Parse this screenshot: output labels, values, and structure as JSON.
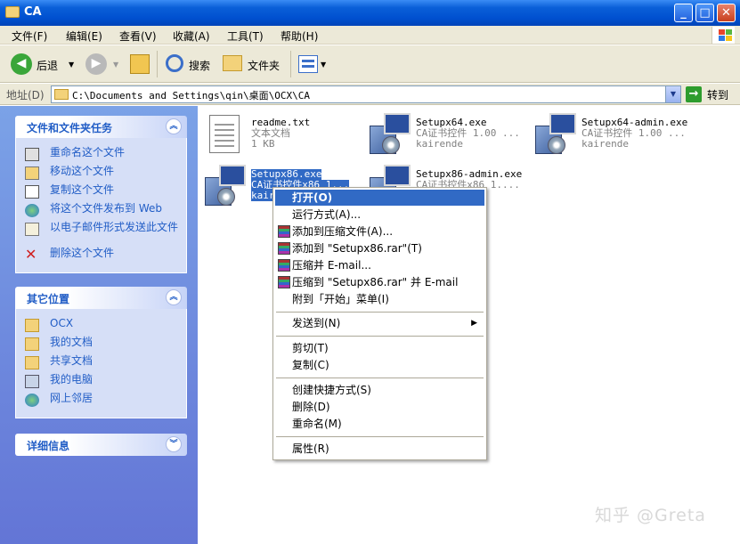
{
  "window": {
    "title": "CA"
  },
  "menubar": [
    "文件(F)",
    "编辑(E)",
    "查看(V)",
    "收藏(A)",
    "工具(T)",
    "帮助(H)"
  ],
  "toolbar": {
    "back": "后退",
    "search": "搜索",
    "folders": "文件夹"
  },
  "address": {
    "label": "地址(D)",
    "path": "C:\\Documents and Settings\\qin\\桌面\\OCX\\CA",
    "go": "转到"
  },
  "tasks_panel": {
    "title": "文件和文件夹任务",
    "items": [
      "重命名这个文件",
      "移动这个文件",
      "复制这个文件",
      "将这个文件发布到 Web",
      "以电子邮件形式发送此文件",
      "删除这个文件"
    ]
  },
  "places_panel": {
    "title": "其它位置",
    "items": [
      "OCX",
      "我的文档",
      "共享文档",
      "我的电脑",
      "网上邻居"
    ]
  },
  "details_panel": {
    "title": "详细信息"
  },
  "files": [
    {
      "name": "readme.txt",
      "line2": "文本文档",
      "line3": "1 KB"
    },
    {
      "name": "Setupx64.exe",
      "line2": "CA证书控件 1.00 ...",
      "line3": "kairende"
    },
    {
      "name": "Setupx64-admin.exe",
      "line2": "CA证书控件 1.00 ...",
      "line3": "kairende"
    },
    {
      "name": "Setupx86.exe",
      "line2": "CA证书控件x86 1...",
      "line3": "kair"
    },
    {
      "name": "Setupx86-admin.exe",
      "line2": "CA证书控件x86 1....",
      "line3": ""
    }
  ],
  "context_menu": [
    "打开(O)",
    "运行方式(A)...",
    "添加到压缩文件(A)...",
    "添加到 \"Setupx86.rar\"(T)",
    "压缩并 E-mail...",
    "压缩到 \"Setupx86.rar\" 并 E-mail",
    "附到「开始」菜单(I)",
    "发送到(N)",
    "剪切(T)",
    "复制(C)",
    "创建快捷方式(S)",
    "删除(D)",
    "重命名(M)",
    "属性(R)"
  ],
  "watermark": "知乎 @Greta",
  "colors": {
    "titlebar": "#0050d0",
    "highlight": "#316ac5",
    "task_link": "#215dc6",
    "left_pane": "#6f8ee0"
  }
}
